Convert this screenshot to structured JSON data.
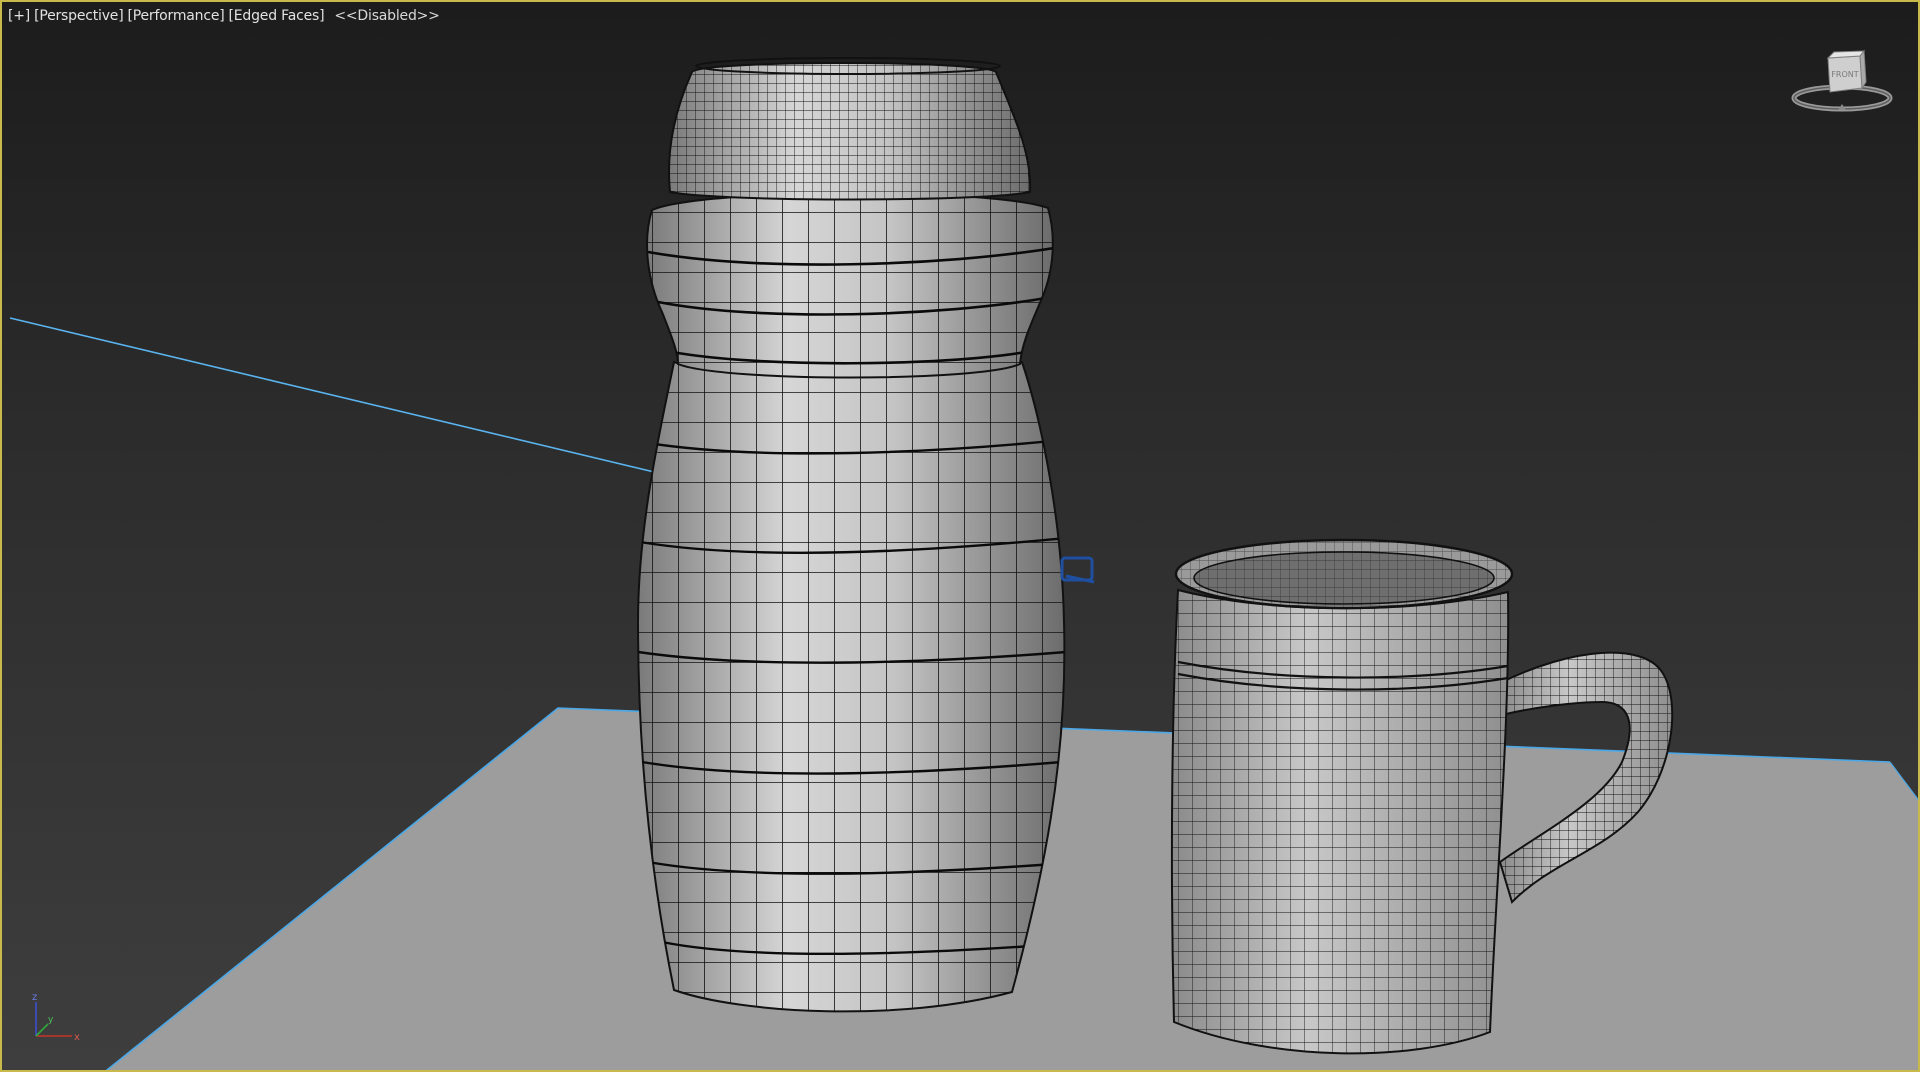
{
  "viewport": {
    "label_plus": "[+]",
    "label_view": "[Perspective]",
    "label_shading": "[Performance]",
    "label_edges": "[Edged Faces]",
    "label_status": "<<Disabled>>",
    "border_color": "#c8b94a"
  },
  "viewcube": {
    "face_label": "FRONT"
  },
  "axis_tripod": {
    "x": "x",
    "y": "y",
    "z": "z"
  },
  "colors": {
    "background_top": "#1c1c1c",
    "background_bottom": "#3e3e3e",
    "ground_plane": "#9d9d9d",
    "mesh_surface": "#bdbdbd",
    "wire": "#111111",
    "camera_line": "#4aa8e8"
  },
  "icons": [
    "viewcube-icon",
    "axis-tripod-icon",
    "camera-target-icon"
  ]
}
